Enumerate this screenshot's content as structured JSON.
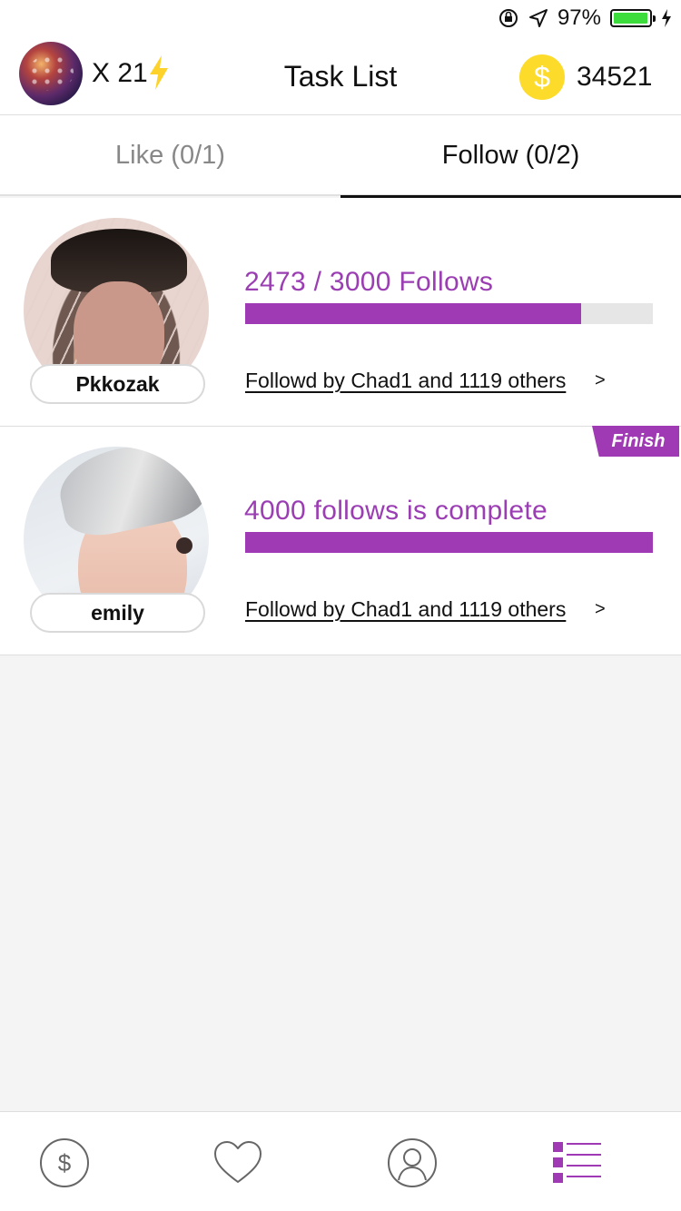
{
  "status_bar": {
    "battery_percent": "97%",
    "battery_level": 0.97,
    "icons": [
      "orientation-lock-icon",
      "location-arrow-icon",
      "battery-icon",
      "charging-icon"
    ]
  },
  "header": {
    "multiplier": "X 21",
    "title": "Task List",
    "coins": "34521",
    "coin_symbol": "$",
    "accent": "#a03ab4",
    "coin_color": "#fddb2b"
  },
  "tabs": [
    {
      "label": "Like (0/1)",
      "active": false
    },
    {
      "label": "Follow (0/2)",
      "active": true
    }
  ],
  "tasks": [
    {
      "name": "Pkkozak",
      "progress_text": "2473 / 3000 Follows",
      "progress": 0.824,
      "followed_text": "Followd by Chad1 and 1119 others",
      "chevron": ">",
      "badge": ""
    },
    {
      "name": "emily",
      "progress_text": "4000 follows is complete",
      "progress": 1.0,
      "followed_text": "Followd by Chad1 and 1119 others",
      "chevron": ">",
      "badge": "Finish"
    }
  ],
  "bottom_nav": {
    "items": [
      "dollar-icon",
      "heart-icon",
      "profile-icon",
      "task-list-icon"
    ],
    "active": "task-list-icon"
  }
}
